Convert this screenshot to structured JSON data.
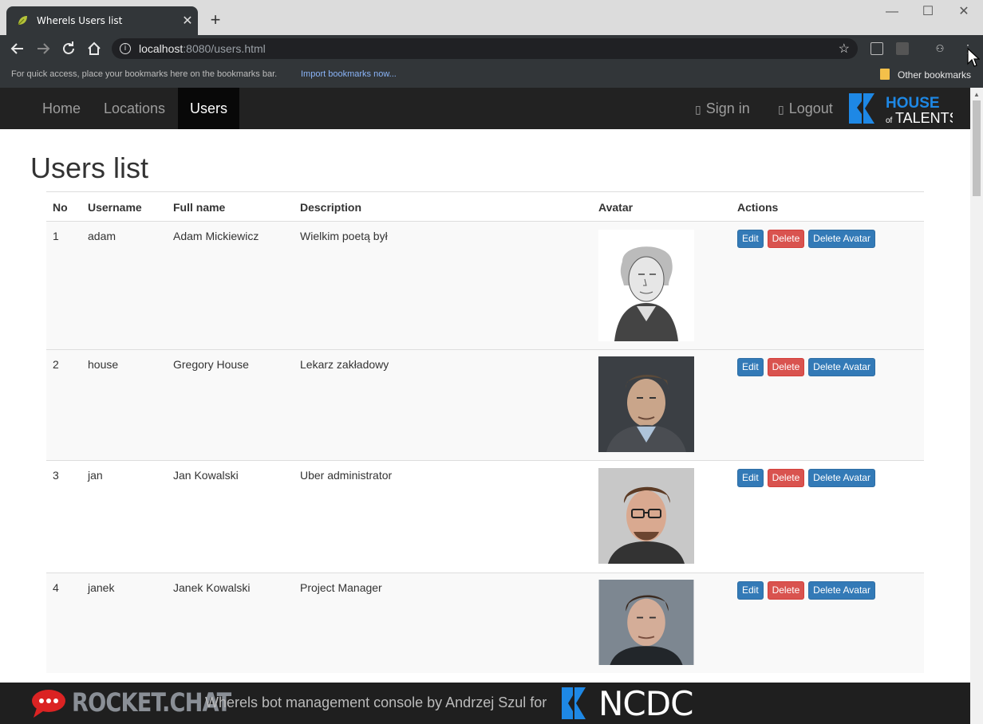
{
  "browser": {
    "tab_title": "Wherels Users list",
    "tab_close": "✕",
    "new_tab": "+",
    "win_min": "—",
    "win_max": "☐",
    "win_close": "✕",
    "url_host": "localhost",
    "url_path": ":8080/users.html",
    "bookmarks_hint": "For quick access, place your bookmarks here on the bookmarks bar.",
    "import_link": "Import bookmarks now...",
    "other_bookmarks": "Other bookmarks"
  },
  "navbar": {
    "items": [
      {
        "label": "Home"
      },
      {
        "label": "Locations"
      },
      {
        "label": "Users"
      }
    ],
    "active": "Users",
    "sign_in": "Sign in",
    "logout": "Logout",
    "logo_text_top": "HOUSE",
    "logo_text_bottom_small": "of",
    "logo_text_bottom": "TALENTS"
  },
  "page": {
    "title": "Users list",
    "columns": [
      "No",
      "Username",
      "Full name",
      "Description",
      "Avatar",
      "Actions"
    ],
    "rows": [
      {
        "no": "1",
        "username": "adam",
        "full_name": "Adam Mickiewicz",
        "description": "Wielkim poetą był"
      },
      {
        "no": "2",
        "username": "house",
        "full_name": "Gregory House",
        "description": "Lekarz zakładowy"
      },
      {
        "no": "3",
        "username": "jan",
        "full_name": "Jan Kowalski",
        "description": "Uber administrator"
      },
      {
        "no": "4",
        "username": "janek",
        "full_name": "Janek Kowalski",
        "description": "Project Manager"
      }
    ],
    "actions": {
      "edit": "Edit",
      "delete": "Delete",
      "delete_avatar": "Delete Avatar"
    }
  },
  "footer": {
    "rocket_chat": "ROCKET.CHAT",
    "caption": "Wherels bot management console by Andrzej Szul for",
    "ncdc": "NCDC"
  },
  "colors": {
    "primary": "#337ab7",
    "danger": "#d9534f",
    "navbar": "#222222",
    "brand_blue": "#1e88e5"
  },
  "icons": [
    "back-icon",
    "forward-icon",
    "reload-icon",
    "home-icon",
    "info-icon",
    "star-icon",
    "user-icon",
    "logout-icon",
    "rocket-chat-icon",
    "menu-icon"
  ]
}
